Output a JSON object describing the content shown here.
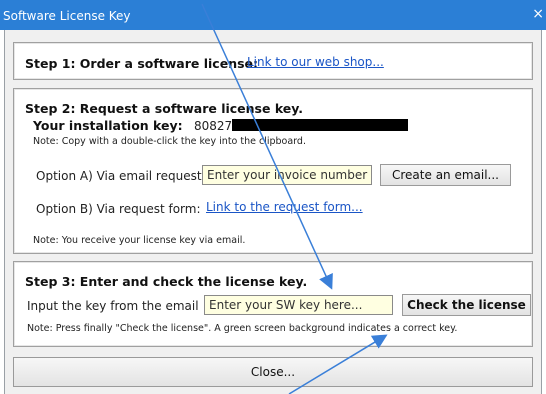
{
  "window": {
    "title": "Software License Key",
    "close_glyph": "×"
  },
  "step1": {
    "heading": "Step 1: Order a software license:",
    "link": "Link to our web shop..."
  },
  "step2": {
    "heading": "Step 2: Request a software license key.",
    "install_key_label": "Your installation key:",
    "install_key_value": "80827",
    "copy_note": "Note: Copy with a double-click the key into the clipboard.",
    "option_a_label": "Option A) Via email request:",
    "invoice_placeholder": "Enter your invoice number here...",
    "create_email_button": "Create an email...",
    "option_b_label": "Option B) Via request form:",
    "request_form_link": "Link to the request form...",
    "email_note": "Note: You receive your license key via email."
  },
  "step3": {
    "heading": "Step 3: Enter and check the license key.",
    "input_label": "Input the key from the email",
    "key_placeholder": "Enter your SW key here...",
    "check_button": "Check the license",
    "final_note": "Note: Press finally \"Check the license\". A green screen background indicates a correct key."
  },
  "footer": {
    "close_button": "Close..."
  },
  "colors": {
    "titlebar": "#2b7fd6",
    "link": "#1a55c6",
    "input_background": "#ffffe1",
    "annotation_arrow": "#3a7fd8"
  }
}
